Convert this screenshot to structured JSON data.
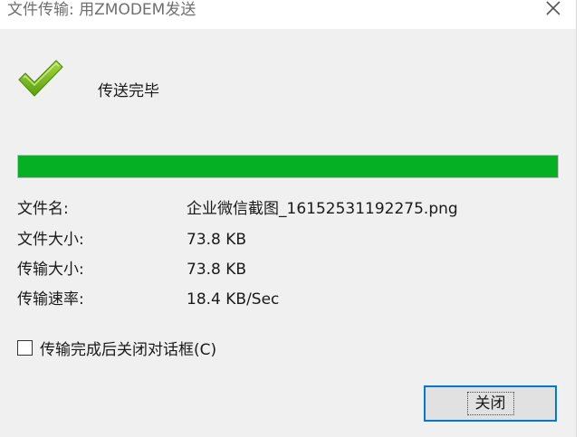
{
  "window": {
    "title": "文件传输: 用ZMODEM发送"
  },
  "status": {
    "message": "传送完毕"
  },
  "progress": {
    "percent": 100,
    "color": "#06b025"
  },
  "info": [
    {
      "label": "文件名:",
      "value": "企业微信截图_16152531192275.png"
    },
    {
      "label": "文件大小:",
      "value": "73.8 KB"
    },
    {
      "label": "传输大小:",
      "value": "73.8 KB"
    },
    {
      "label": "传输速率:",
      "value": "18.4 KB/Sec"
    }
  ],
  "options": {
    "close_after_transfer_label": "传输完成后关闭对话框(C)",
    "close_after_transfer_checked": false
  },
  "buttons": {
    "close_label": "关闭"
  },
  "colors": {
    "accent": "#0078d7",
    "check_green": "#7fc31c"
  }
}
